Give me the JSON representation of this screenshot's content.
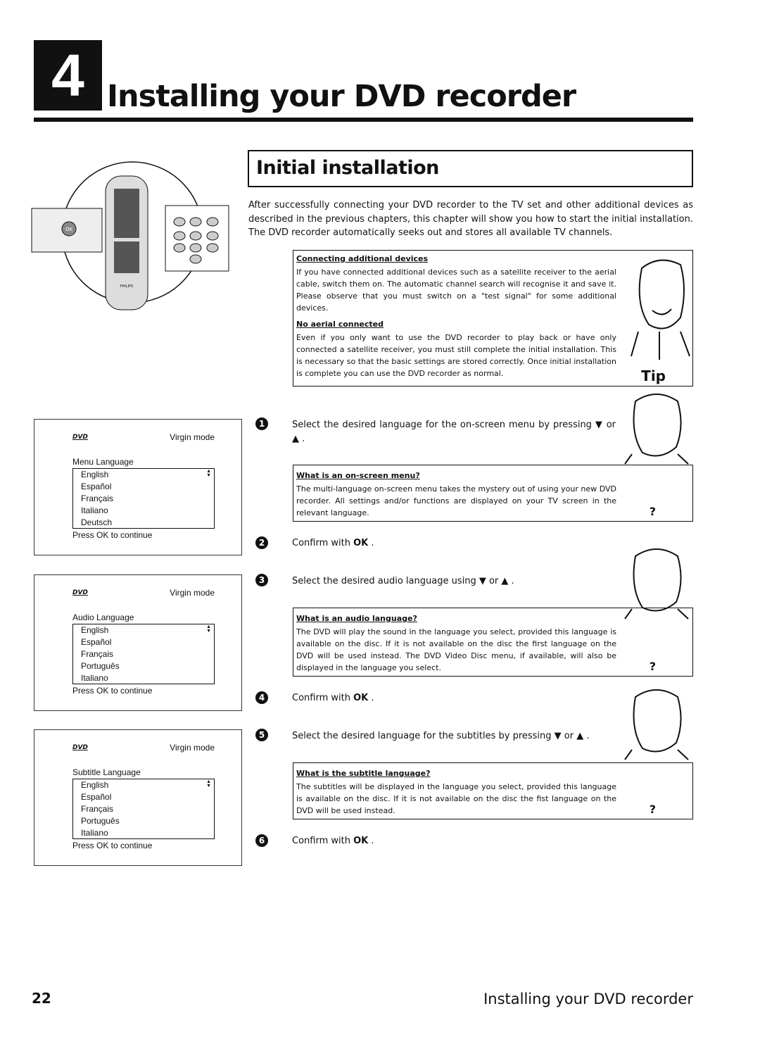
{
  "header": {
    "chapter_number": "4",
    "chapter_title": "Installing your DVD recorder"
  },
  "section": {
    "title": "Initial installation",
    "intro": "After successfully connecting your DVD recorder to the TV set and other additional devices as described in the previous chapters, this chapter will show you how to start the initial installation. The DVD recorder automatically seeks out and stores all available TV channels."
  },
  "tip": {
    "label": "Tip",
    "items": [
      {
        "heading": "Connecting additional devices",
        "text": "If you have connected additional devices such as a satellite receiver to the aerial cable, switch them on. The automatic channel search will recognise it and save it. Please observe that you must switch on a \"test signal\" for some additional devices."
      },
      {
        "heading": "No aerial connected",
        "text": "Even if you only want to use the DVD recorder to play back or have only connected a satellite receiver, you must still complete the initial installation. This is necessary so that the basic settings are stored correctly. Once initial installation is complete you can use the DVD recorder as normal."
      }
    ]
  },
  "steps": [
    {
      "num": "1",
      "text": "Select the desired language for the on-screen menu by pressing ▼ or ▲ ."
    },
    {
      "num": "2",
      "text": "Confirm with",
      "key": "OK",
      "end": " ."
    },
    {
      "num": "3",
      "text": "Select the desired audio language using ▼ or ▲ ."
    },
    {
      "num": "4",
      "text": "Confirm with",
      "key": "OK",
      "end": " ."
    },
    {
      "num": "5",
      "text": "Select the desired language for the subtitles by pressing ▼ or ▲ ."
    },
    {
      "num": "6",
      "text": "Confirm with",
      "key": "OK",
      "end": " ."
    }
  ],
  "questions": [
    {
      "heading": "What is an on-screen menu?",
      "text": "The multi-language on-screen menu takes the mystery out of using your new DVD recorder. All settings and/or functions are displayed on your TV screen in the relevant language.",
      "mark": "?"
    },
    {
      "heading": "What is an audio language?",
      "text": "The DVD will play the sound in the language you select, provided this language is available on the disc. If it is not available on the disc the first language on the DVD will be used instead. The DVD Video Disc menu, if available, will also be displayed in the language you select.",
      "mark": "?"
    },
    {
      "heading": "What is the subtitle language?",
      "text": "The subtitles will be displayed in the language you select, provided this language is available on the disc. If it is not available on the disc the fist language on the DVD will be used instead.",
      "mark": "?"
    }
  ],
  "screens": [
    {
      "logo": "DVD",
      "mode": "Virgin mode",
      "label": "Menu Language",
      "options": [
        "English",
        "Español",
        "Français",
        "Italiano",
        "Deutsch"
      ],
      "footer": "Press OK to continue"
    },
    {
      "logo": "DVD",
      "mode": "Virgin mode",
      "label": "Audio Language",
      "options": [
        "English",
        "Español",
        "Français",
        "Português",
        "Italiano"
      ],
      "footer": "Press OK to continue"
    },
    {
      "logo": "DVD",
      "mode": "Virgin mode",
      "label": "Subtitle Language",
      "options": [
        "English",
        "Español",
        "Français",
        "Português",
        "Italiano"
      ],
      "footer": "Press OK to continue"
    }
  ],
  "remote": {
    "brand": "PHILIPS",
    "keys": [
      "1",
      "2",
      "3",
      "4",
      "5",
      "6",
      "7",
      "8",
      "9",
      "0"
    ],
    "ok": "OK"
  },
  "footer": {
    "page_number": "22",
    "running_title": "Installing your DVD recorder"
  }
}
